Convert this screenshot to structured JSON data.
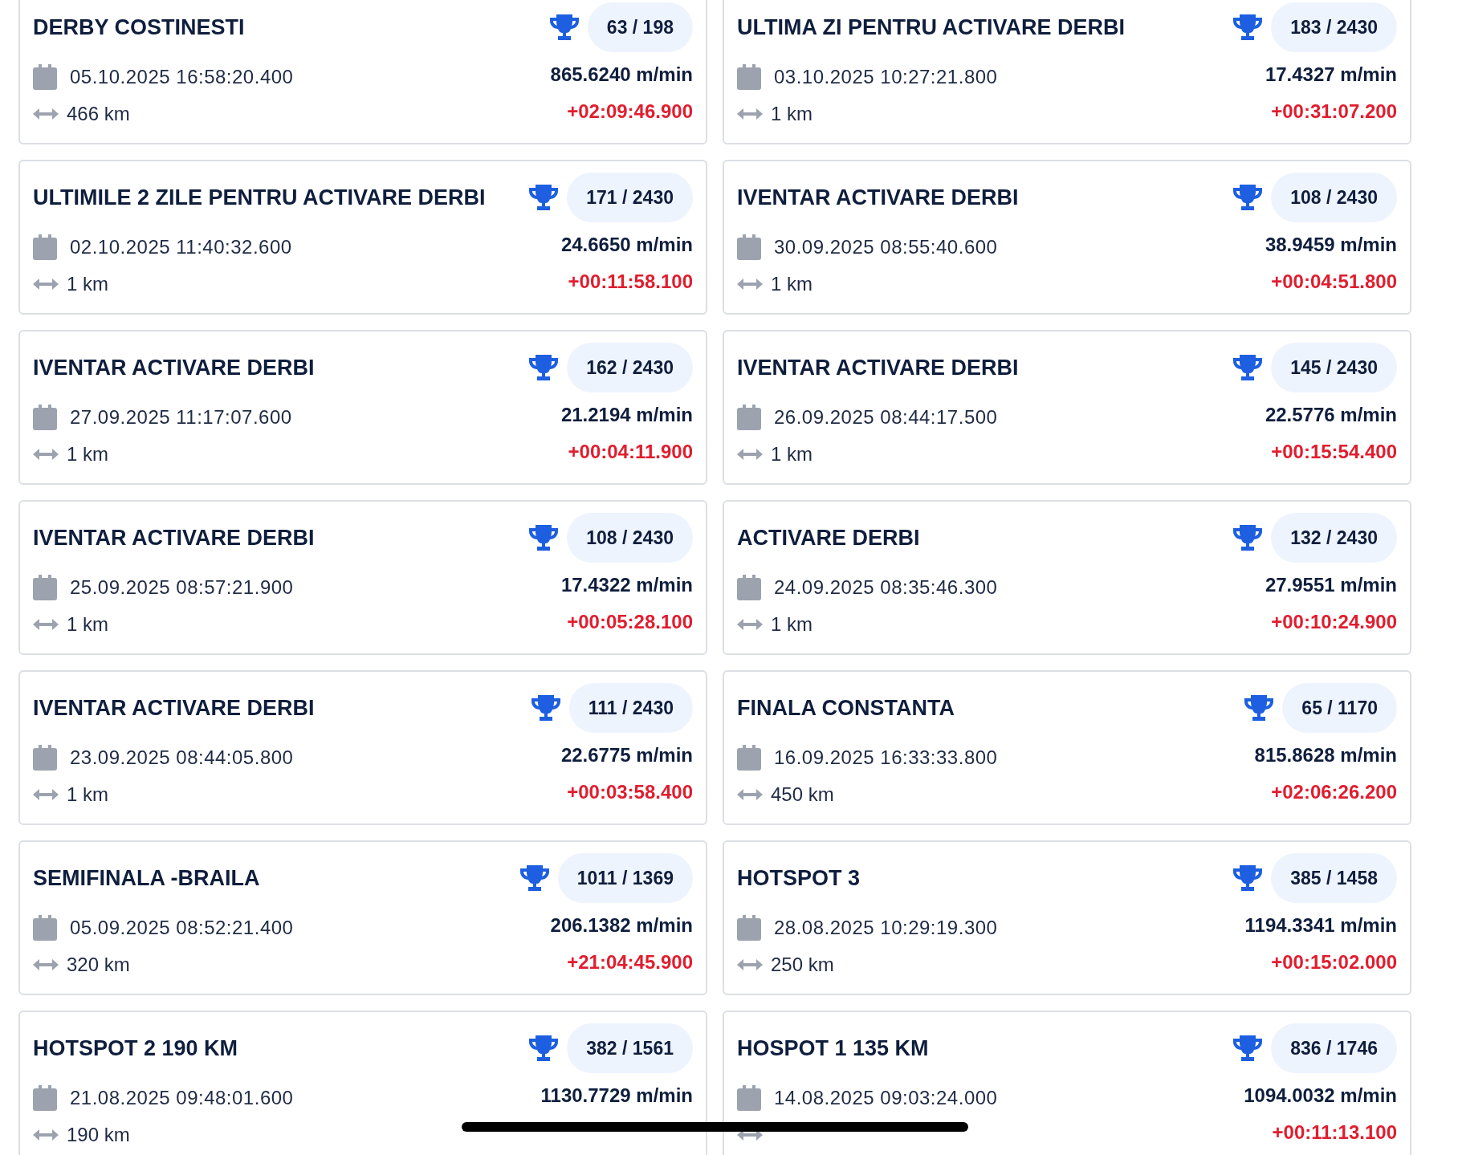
{
  "results": [
    {
      "title": "DERBY COSTINESTI",
      "rank": "63 / 198",
      "date": "05.10.2025 16:58:20.400",
      "speed": "865.6240 m/min",
      "distance": "466 km",
      "delta": "+02:09:46.900"
    },
    {
      "title": "ULTIMA ZI PENTRU ACTIVARE DERBI",
      "rank": "183 / 2430",
      "date": "03.10.2025 10:27:21.800",
      "speed": "17.4327 m/min",
      "distance": "1 km",
      "delta": "+00:31:07.200"
    },
    {
      "title": "ULTIMILE 2 ZILE PENTRU ACTIVARE DERBI",
      "rank": "171 / 2430",
      "date": "02.10.2025 11:40:32.600",
      "speed": "24.6650 m/min",
      "distance": "1 km",
      "delta": "+00:11:58.100"
    },
    {
      "title": "IVENTAR ACTIVARE DERBI",
      "rank": "108 / 2430",
      "date": "30.09.2025 08:55:40.600",
      "speed": "38.9459 m/min",
      "distance": "1 km",
      "delta": "+00:04:51.800"
    },
    {
      "title": "IVENTAR ACTIVARE DERBI",
      "rank": "162 / 2430",
      "date": "27.09.2025 11:17:07.600",
      "speed": "21.2194 m/min",
      "distance": "1 km",
      "delta": "+00:04:11.900"
    },
    {
      "title": "IVENTAR ACTIVARE DERBI",
      "rank": "145 / 2430",
      "date": "26.09.2025 08:44:17.500",
      "speed": "22.5776 m/min",
      "distance": "1 km",
      "delta": "+00:15:54.400"
    },
    {
      "title": "IVENTAR ACTIVARE DERBI",
      "rank": "108 / 2430",
      "date": "25.09.2025 08:57:21.900",
      "speed": "17.4322 m/min",
      "distance": "1 km",
      "delta": "+00:05:28.100"
    },
    {
      "title": "ACTIVARE DERBI",
      "rank": "132 / 2430",
      "date": "24.09.2025 08:35:46.300",
      "speed": "27.9551 m/min",
      "distance": "1 km",
      "delta": "+00:10:24.900"
    },
    {
      "title": "IVENTAR ACTIVARE DERBI",
      "rank": "111 / 2430",
      "date": "23.09.2025 08:44:05.800",
      "speed": "22.6775 m/min",
      "distance": "1 km",
      "delta": "+00:03:58.400"
    },
    {
      "title": "FINALA CONSTANTA",
      "rank": "65 / 1170",
      "date": "16.09.2025 16:33:33.800",
      "speed": "815.8628 m/min",
      "distance": "450 km",
      "delta": "+02:06:26.200"
    },
    {
      "title": "SEMIFINALA -BRAILA",
      "rank": "1011 / 1369",
      "date": "05.09.2025 08:52:21.400",
      "speed": "206.1382 m/min",
      "distance": "320 km",
      "delta": "+21:04:45.900"
    },
    {
      "title": "HOTSPOT 3",
      "rank": "385 / 1458",
      "date": "28.08.2025 10:29:19.300",
      "speed": "1194.3341 m/min",
      "distance": "250 km",
      "delta": "+00:15:02.000"
    },
    {
      "title": "HOTSPOT 2 190 KM",
      "rank": "382 / 1561",
      "date": "21.08.2025 09:48:01.600",
      "speed": "1130.7729 m/min",
      "distance": "190 km"
    },
    {
      "title": "HOSPOT 1 135 KM",
      "rank": "836 / 1746",
      "date": "14.08.2025 09:03:24.000",
      "speed": "1094.0032 m/min",
      "delta": "+00:11:13.100"
    }
  ]
}
